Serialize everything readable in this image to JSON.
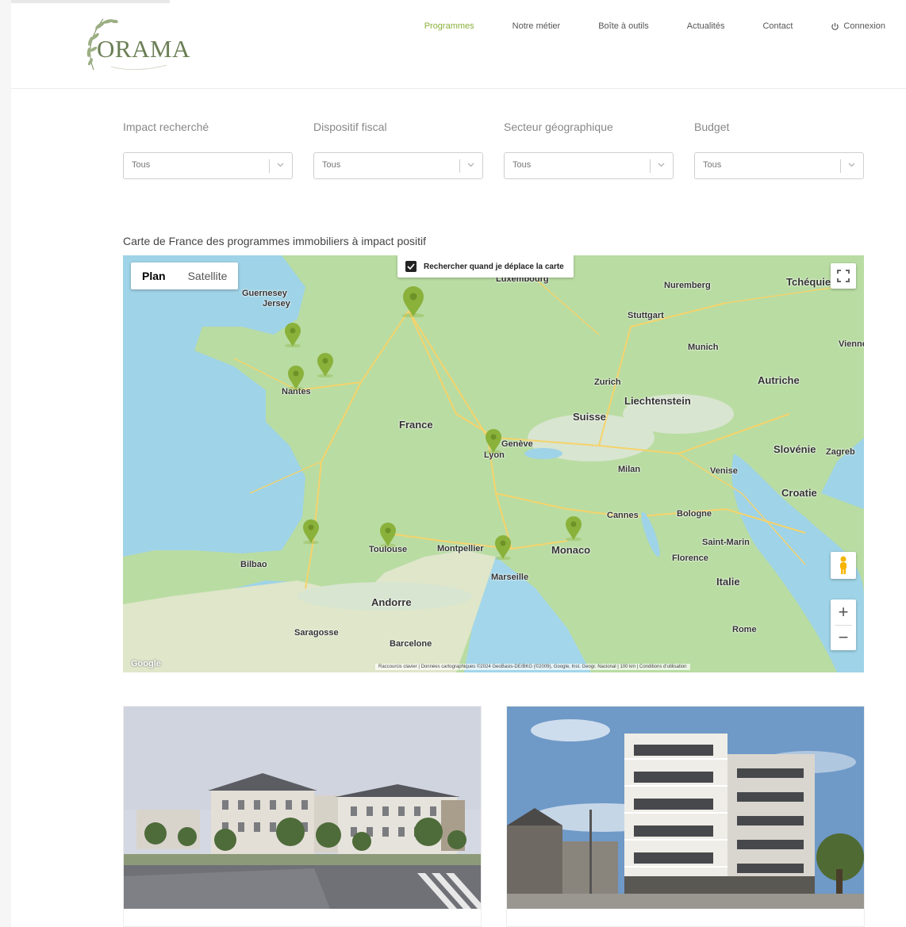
{
  "brand": {
    "name": "ORAMA",
    "accent": "#8ab13a",
    "logo_color": "#6b7f55"
  },
  "nav": {
    "items": [
      {
        "label": "Programmes",
        "active": true
      },
      {
        "label": "Notre métier",
        "active": false
      },
      {
        "label": "Boîte à outils",
        "active": false
      },
      {
        "label": "Actualités",
        "active": false
      },
      {
        "label": "Contact",
        "active": false
      }
    ],
    "login_label": "Connexion",
    "login_icon": "power-icon"
  },
  "filters": [
    {
      "label": "Impact recherché",
      "value": "Tous"
    },
    {
      "label": "Dispositif fiscal",
      "value": "Tous"
    },
    {
      "label": "Secteur géographique",
      "value": "Tous"
    },
    {
      "label": "Budget",
      "value": "Tous"
    }
  ],
  "map": {
    "title": "Carte de France des programmes immobiliers à impact positif",
    "type_plan": "Plan",
    "type_satellite": "Satellite",
    "search_toggle_label": "Rechercher quand je déplace la carte",
    "search_toggle_checked": true,
    "zoom_in": "+",
    "zoom_out": "−",
    "attribution": "Raccourcis clavier | Données cartographiques ©2024 GeoBasis-DE/BKG (©2009), Google, Inst. Geogr. Nacional | 100 km | Conditions d'utilisation",
    "google_logo": "Google",
    "countries": [
      "France",
      "Suisse",
      "Liechtenstein",
      "Autriche",
      "Slovénie",
      "Croatie",
      "Italie",
      "Andorre",
      "Monaco",
      "Tchéquie"
    ],
    "cities": [
      "Guernesey",
      "Jersey",
      "Nantes",
      "Toulouse",
      "Montpellier",
      "Marseille",
      "Lyon",
      "Genève",
      "Luxembourg",
      "Stuttgart",
      "Munich",
      "Nuremberg",
      "Milan",
      "Venise",
      "Bologne",
      "Florence",
      "Saint-Marin",
      "Rome",
      "Cannes",
      "Zagreb",
      "Saragosse",
      "Barcelone",
      "Bilbao",
      "Zurich",
      "Vienne"
    ]
  }
}
